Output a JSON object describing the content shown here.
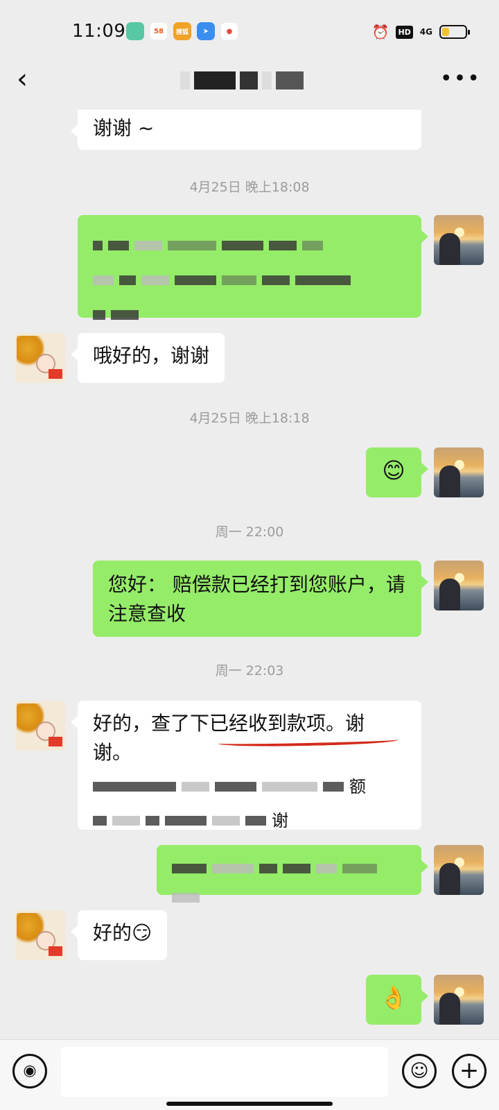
{
  "status_bar": {
    "time": "11:09",
    "app_icons": [
      "messages-app-icon",
      "58-app-icon",
      "sohu-app-icon",
      "feishu-app-icon",
      "map-pin-app-icon"
    ],
    "app_icon_labels": [
      "",
      "58",
      "搜狐",
      "",
      ""
    ],
    "sys": {
      "hd": "HD",
      "network": "4G",
      "battery_percent": 30
    }
  },
  "nav": {
    "back_icon": "chevron-left-icon",
    "more_icon": "more-dots-icon",
    "more": "•••"
  },
  "conversation": {
    "top_partial_in": "谢谢 ~",
    "ts1": "4月25日 晚上18:08",
    "msg_in_2": "哦好的，谢谢",
    "ts2": "4月25日 晚上18:18",
    "emoji_out": "😊",
    "ts3": "周一 22:00",
    "msg_out_4": "您好：      赔偿款已经打到您账户，请注意查收",
    "ts4": "周一 22:03",
    "msg_in_5_line1": "好的，查了下已经收到款项。谢",
    "msg_in_5_line2": "谢。",
    "msg_in_5_blur_end": "额",
    "msg_in_5_blur_end2": "谢",
    "msg_in_6": "好的😏",
    "ok_out": "👌"
  },
  "input_bar": {
    "voice_icon": "voice-icon",
    "emoji_icon": "emoji-icon",
    "plus_icon": "plus-icon",
    "voice_glyph": "◉",
    "emoji_glyph": "☺",
    "plus_glyph": "+"
  },
  "colors": {
    "incoming": "#ffffff",
    "outgoing": "#95ec69",
    "background": "#ededed",
    "highlight": "#d32a1b"
  }
}
